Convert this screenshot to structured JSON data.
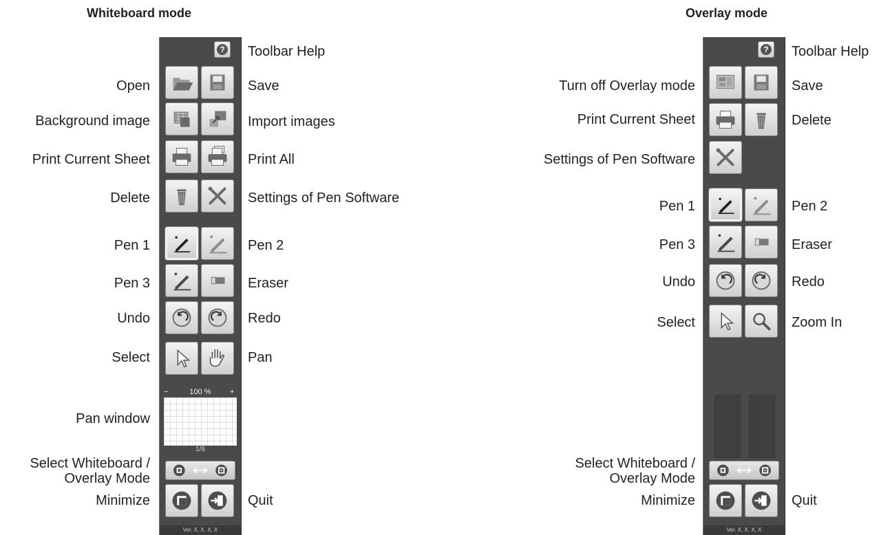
{
  "headings": {
    "whiteboard": "Whiteboard mode",
    "overlay": "Overlay mode"
  },
  "whiteboard": {
    "labels_left": [
      "Open",
      "Background image",
      "Print Current Sheet",
      "Delete",
      "Pen 1",
      "Pen 3",
      "Undo",
      "Select",
      "Pan window",
      "Select Whiteboard /",
      "Overlay Mode",
      "Minimize"
    ],
    "labels_right": [
      "Toolbar Help",
      "Save",
      "Import images",
      "Print All",
      "Settings of Pen Software",
      "Pen 2",
      "Eraser",
      "Redo",
      "Pan",
      "Quit"
    ],
    "help_glyph": "?",
    "zoom_minus": "−",
    "zoom_value": "100 %",
    "zoom_plus": "+",
    "page_indicator": "1/8",
    "version": "Ver. X, X, X, X",
    "icons": [
      "open-icon",
      "save-icon",
      "background-image-icon",
      "import-images-icon",
      "print-icon",
      "print-all-icon",
      "delete-icon",
      "settings-icon",
      "pen-1-icon",
      "pen-2-icon",
      "pen-3-icon",
      "eraser-icon",
      "undo-icon",
      "redo-icon",
      "select-icon",
      "pan-icon",
      "mode-switch-icon",
      "minimize-icon",
      "quit-icon"
    ]
  },
  "overlay": {
    "labels_left": [
      "Turn off Overlay mode",
      "Print Current Sheet",
      "Settings of Pen Software",
      "Pen 1",
      "Pen 3",
      "Undo",
      "Select",
      "Select Whiteboard /",
      "Overlay Mode",
      "Minimize"
    ],
    "labels_right": [
      "Toolbar Help",
      "Save",
      "Delete",
      "Pen 2",
      "Eraser",
      "Redo",
      "Zoom In",
      "Quit"
    ],
    "help_glyph": "?",
    "version": "Ver. X, X, X, X",
    "icons": [
      "overlay-off-icon",
      "save-icon",
      "print-icon",
      "delete-icon",
      "settings-icon",
      "pen-1-icon",
      "pen-2-icon",
      "pen-3-icon",
      "eraser-icon",
      "undo-icon",
      "redo-icon",
      "select-icon",
      "zoom-in-icon",
      "mode-switch-icon",
      "minimize-icon",
      "quit-icon"
    ]
  },
  "colors": {
    "toolbar": "#4a4a4a",
    "button": "#e2e2e2",
    "text": "#231f20"
  }
}
